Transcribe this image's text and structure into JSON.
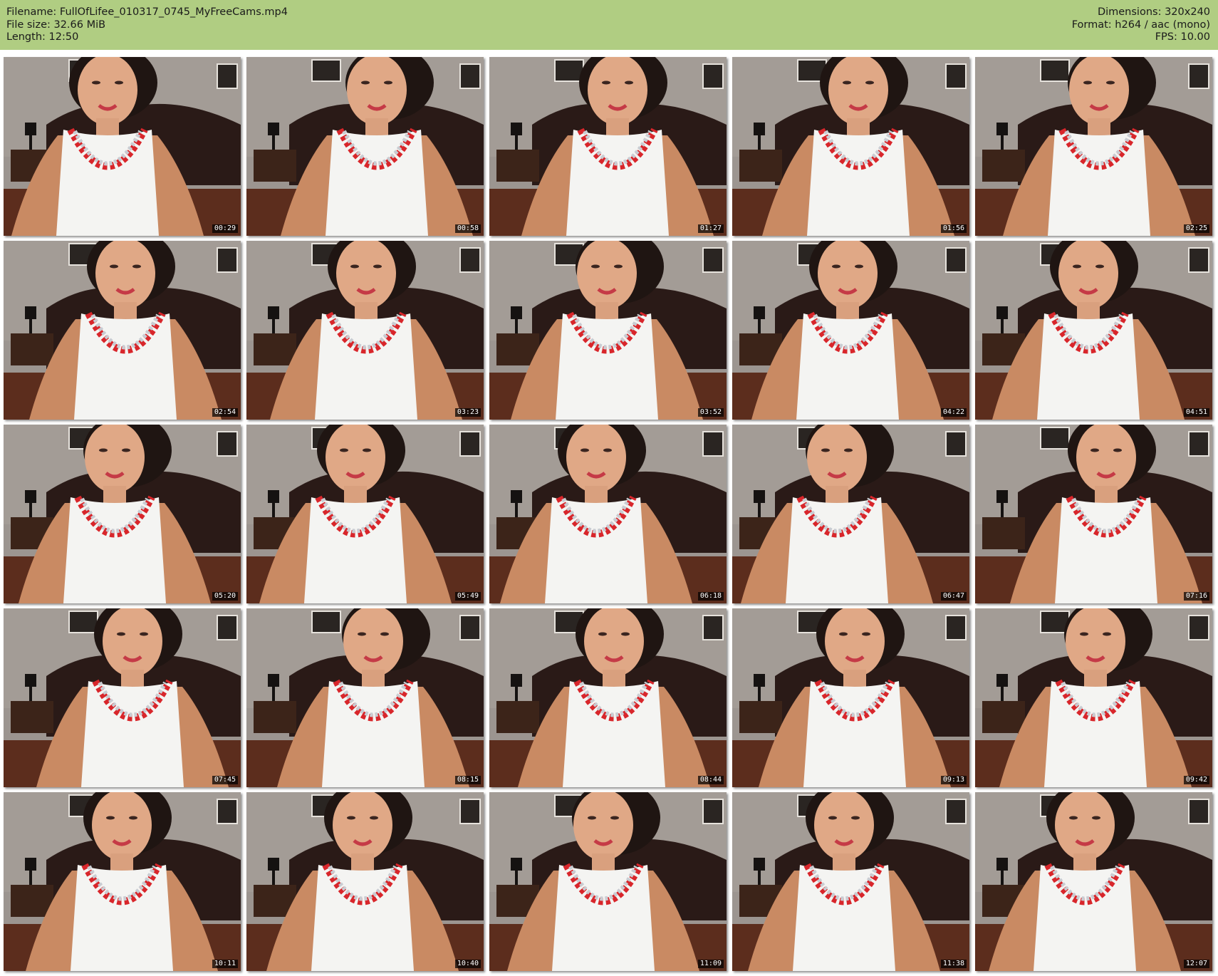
{
  "header": {
    "left": [
      {
        "label": "Filename:",
        "value": "FullOfLifee_010317_0745_MyFreeCams.mp4"
      },
      {
        "label": "File size:",
        "value": "32.66 MiB"
      },
      {
        "label": "Length:",
        "value": "12:50"
      }
    ],
    "right": [
      {
        "label": "Dimensions:",
        "value": "320x240"
      },
      {
        "label": "Format:",
        "value": "h264 / aac (mono)"
      },
      {
        "label": "FPS:",
        "value": "10.00"
      }
    ]
  },
  "colors": {
    "header_bg": "#b0cd82",
    "page_bg": "#ffffff",
    "top_white": "#f4f4f2",
    "top_trim_red": "#d8262b",
    "top_trim_silver": "#c9ccd2",
    "wall": "#9c9590",
    "floor": "#5c2d1d"
  },
  "thumbnails": [
    {
      "time": "00:29"
    },
    {
      "time": "00:58"
    },
    {
      "time": "01:27"
    },
    {
      "time": "01:56"
    },
    {
      "time": "02:25"
    },
    {
      "time": "02:54"
    },
    {
      "time": "03:23"
    },
    {
      "time": "03:52"
    },
    {
      "time": "04:22"
    },
    {
      "time": "04:51"
    },
    {
      "time": "05:20"
    },
    {
      "time": "05:49"
    },
    {
      "time": "06:18"
    },
    {
      "time": "06:47"
    },
    {
      "time": "07:16"
    },
    {
      "time": "07:45"
    },
    {
      "time": "08:15"
    },
    {
      "time": "08:44"
    },
    {
      "time": "09:13"
    },
    {
      "time": "09:42"
    },
    {
      "time": "10:11"
    },
    {
      "time": "10:40"
    },
    {
      "time": "11:09"
    },
    {
      "time": "11:38"
    },
    {
      "time": "12:07"
    }
  ]
}
